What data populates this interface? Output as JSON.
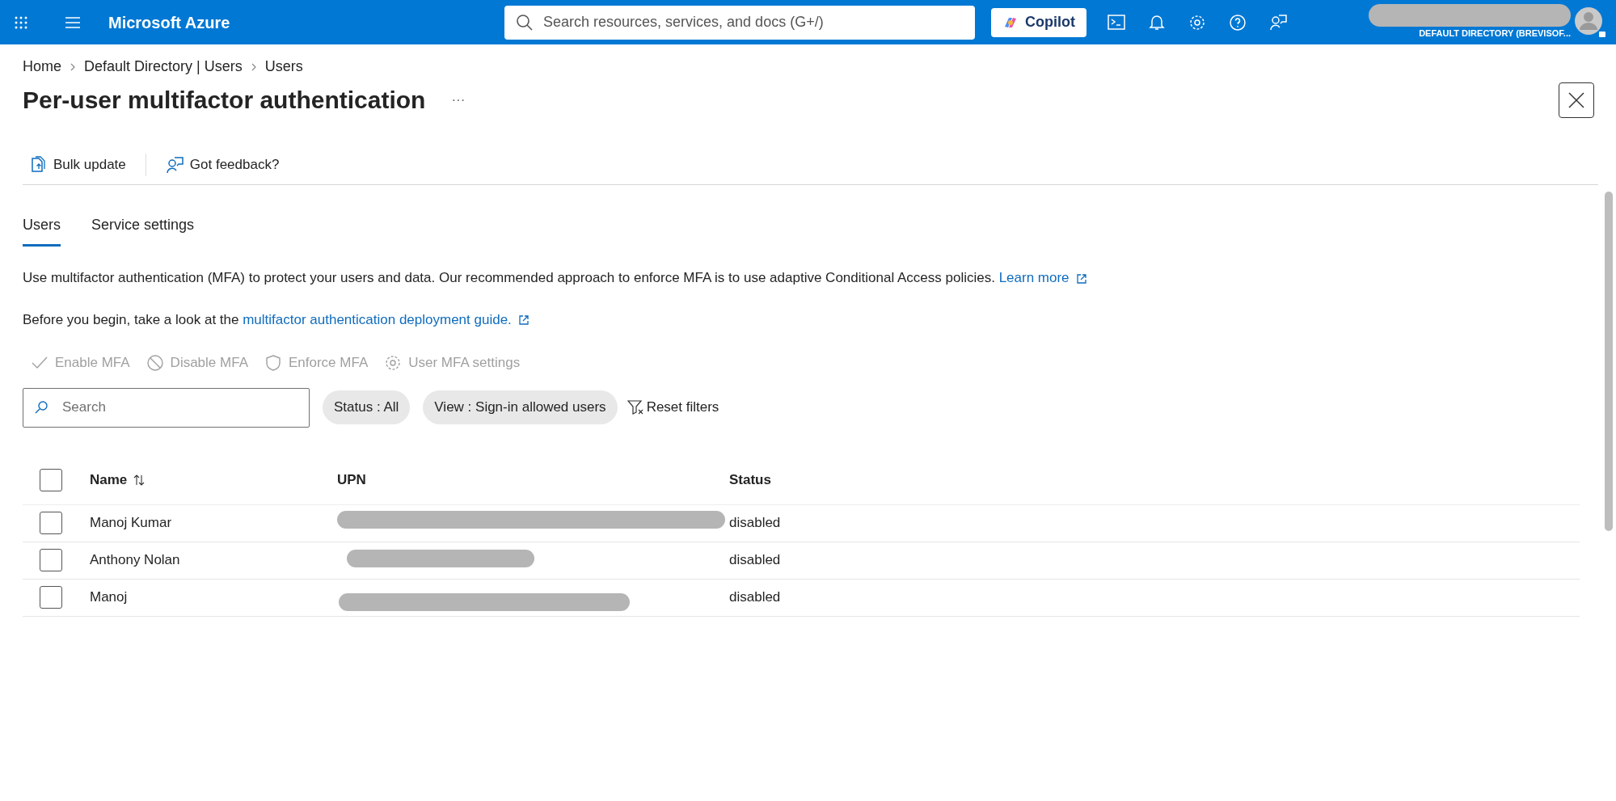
{
  "topbar": {
    "brand": "Microsoft Azure",
    "search": {
      "placeholder": "Search resources, services, and docs (G+/)"
    },
    "copilot": "Copilot",
    "directory": "DEFAULT DIRECTORY (BREVISOF..."
  },
  "breadcrumb": [
    "Home",
    "Default Directory | Users",
    "Users"
  ],
  "page": {
    "title": "Per-user multifactor authentication",
    "more": "···"
  },
  "toolbar": [
    {
      "kind": "bulk",
      "label": "Bulk update"
    },
    {
      "kind": "feedback",
      "label": "Got feedback?"
    }
  ],
  "tabs": [
    {
      "label": "Users",
      "selected": true
    },
    {
      "label": "Service settings",
      "selected": false
    }
  ],
  "info": {
    "text": "Use multifactor authentication (MFA) to protect your users and data. Our recommended approach to enforce MFA is to use adaptive Conditional Access policies.",
    "link": "Learn more"
  },
  "guide": {
    "text": "Before you begin, take a look at the",
    "link": "multifactor authentication deployment guide."
  },
  "actions": [
    {
      "kind": "check",
      "label": "Enable MFA",
      "disabled": true
    },
    {
      "kind": "block",
      "label": "Disable MFA",
      "disabled": true
    },
    {
      "kind": "shield",
      "label": "Enforce MFA",
      "disabled": true
    },
    {
      "kind": "gear",
      "label": "User MFA settings",
      "disabled": true
    }
  ],
  "filters": {
    "search": {
      "placeholder": "Search"
    },
    "pills": [
      "Status : All",
      "View : Sign-in allowed users"
    ],
    "reset": "Reset filters"
  },
  "table": {
    "columns": [
      "Name",
      "UPN",
      "Status"
    ],
    "select_all": {
      "checked": false
    },
    "rows": [
      {
        "name": "Manoj Kumar",
        "status": "disabled",
        "checked": false
      },
      {
        "name": "Anthony Nolan",
        "status": "disabled",
        "checked": false
      },
      {
        "name": "Manoj",
        "status": "disabled",
        "checked": false
      }
    ]
  }
}
